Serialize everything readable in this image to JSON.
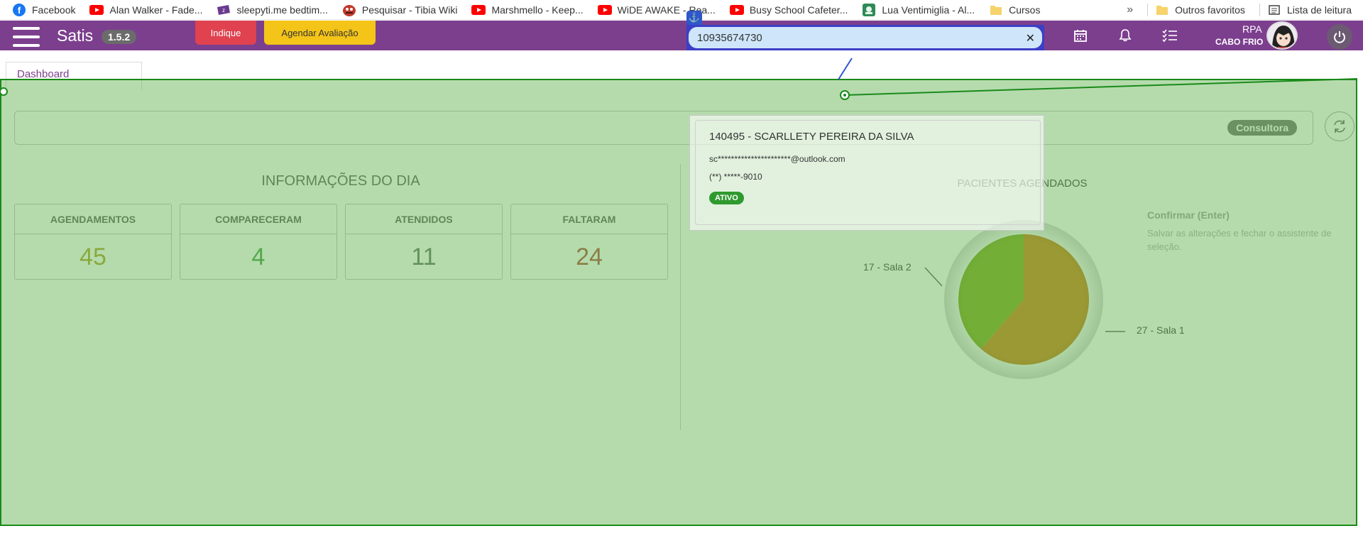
{
  "bookmarks": {
    "items": [
      {
        "label": "Facebook",
        "icon": "facebook-icon",
        "color": "#1877f2"
      },
      {
        "label": "Alan Walker - Fade...",
        "icon": "youtube-icon",
        "color": "#ff0000"
      },
      {
        "label": "sleepyti.me bedtim...",
        "icon": "sleepytime-icon",
        "color": "#6b3a8e"
      },
      {
        "label": "Pesquisar - Tibia Wiki",
        "icon": "tibia-icon",
        "color": "#c0392b"
      },
      {
        "label": "Marshmello - Keep...",
        "icon": "youtube-icon",
        "color": "#ff0000"
      },
      {
        "label": "WiDE AWAKE - Rea...",
        "icon": "youtube-icon",
        "color": "#ff0000"
      },
      {
        "label": "Busy School Cafeter...",
        "icon": "youtube-icon",
        "color": "#ff0000"
      },
      {
        "label": "Lua Ventimiglia - Al...",
        "icon": "lua-icon",
        "color": "#2e8b57"
      },
      {
        "label": "Cursos",
        "icon": "folder-icon",
        "color": "#f6d36b"
      }
    ],
    "overflow": "»",
    "other_favorites": "Outros favoritos",
    "reading_list": "Lista de leitura"
  },
  "header": {
    "brand": "Satis",
    "version": "1.5.2",
    "indique_label": "Indique",
    "agendar_label": "Agendar Avaliação",
    "search_value": "10935674730",
    "search_clear": "✕",
    "user_name": "RPA",
    "user_location": "CABO FRIO"
  },
  "tabs": {
    "dashboard": "Dashboard"
  },
  "info_bar": {
    "role_badge": "Consultora"
  },
  "daily_info": {
    "title": "INFORMAÇÕES DO DIA",
    "stats": [
      {
        "label": "AGENDAMENTOS",
        "value": "45",
        "color": "#a89a1a"
      },
      {
        "label": "COMPARECERAM",
        "value": "4",
        "color": "#3a9a3a"
      },
      {
        "label": "ATENDIDOS",
        "value": "11",
        "color": "#5a6a5a"
      },
      {
        "label": "FALTARAM",
        "value": "24",
        "color": "#a8452f"
      }
    ]
  },
  "scheduled": {
    "title": "PACIENTES AGENDADOS"
  },
  "chart_data": {
    "type": "pie",
    "title": "PACIENTES AGENDADOS",
    "slices": [
      {
        "label": "27 - Sala 1",
        "value": 27,
        "color": "#c97a0c"
      },
      {
        "label": "17 - Sala 2",
        "value": 17,
        "color": "#7aa512"
      }
    ]
  },
  "search_result": {
    "name": "140495 - SCARLLETY PEREIRA DA SILVA",
    "email": "sc**********************@outlook.com",
    "phone": "(**) *****-9010",
    "status": "ATIVO"
  },
  "tooltip": {
    "title": "Confirmar (Enter)",
    "text": "Salvar as alterações e fechar o assistente de seleção."
  }
}
